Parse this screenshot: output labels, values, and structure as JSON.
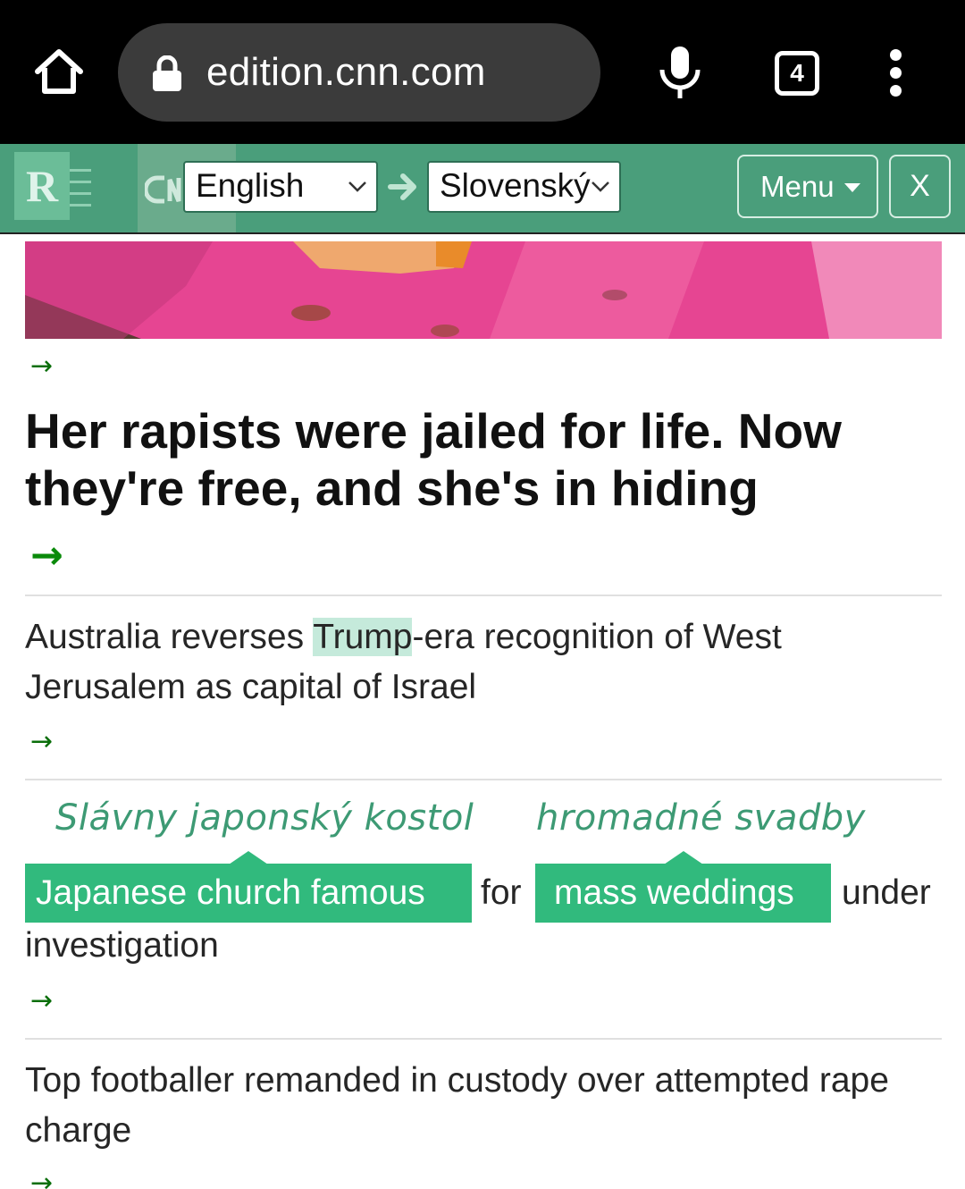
{
  "browser": {
    "url": "edition.cnn.com",
    "tab_count": "4"
  },
  "translator": {
    "logo_letter": "R",
    "source_language": "English",
    "target_language": "Slovenský",
    "menu_label": "Menu",
    "close_label": "X",
    "accent_color": "#4a9e7b"
  },
  "articles": {
    "arrow": "→",
    "headline": "Her rapists were jailed for life. Now they're free, and she's in hiding",
    "story2": {
      "before": "Australia reverses ",
      "highlight": "Trump",
      "after": "-era recognition of West Jerusalem as capital of Israel"
    },
    "story3": {
      "chip1_text": "Japanese church famous",
      "chip1_translation": "Slávny japonský kostol",
      "connector": "for",
      "chip2_text": "mass weddings",
      "chip2_translation": "hromadné svadby",
      "tail": "under",
      "line2": "investigation"
    },
    "story4": "Top footballer remanded in custody over attempted rape charge"
  }
}
